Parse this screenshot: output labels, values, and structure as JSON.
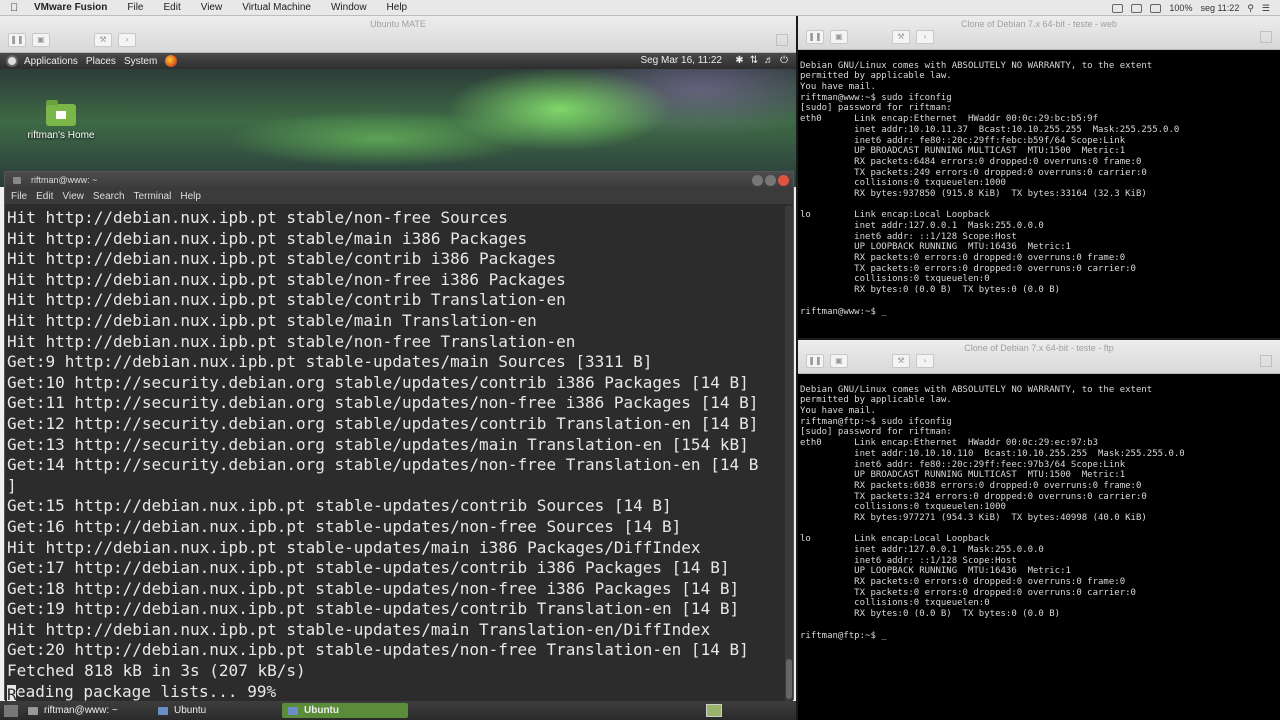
{
  "menubar": {
    "app": "VMware Fusion",
    "items": [
      "File",
      "Edit",
      "View",
      "Virtual Machine",
      "Window",
      "Help"
    ],
    "right": {
      "battery": "100%",
      "clock": "seg 11:22"
    }
  },
  "vm_left": {
    "title": "Ubuntu MATE"
  },
  "mate_panel": {
    "menus": [
      "Applications",
      "Places",
      "System"
    ],
    "clock": "Seg Mar 16, 11:22"
  },
  "desktop": {
    "home_label": "riftman's Home"
  },
  "terminal": {
    "title": "riftman@www: ~",
    "menu": [
      "File",
      "Edit",
      "View",
      "Search",
      "Terminal",
      "Help"
    ],
    "lines": [
      "Hit http://debian.nux.ipb.pt stable/non-free Sources",
      "Hit http://debian.nux.ipb.pt stable/main i386 Packages",
      "Hit http://debian.nux.ipb.pt stable/contrib i386 Packages",
      "Hit http://debian.nux.ipb.pt stable/non-free i386 Packages",
      "Hit http://debian.nux.ipb.pt stable/contrib Translation-en",
      "Hit http://debian.nux.ipb.pt stable/main Translation-en",
      "Hit http://debian.nux.ipb.pt stable/non-free Translation-en",
      "Get:9 http://debian.nux.ipb.pt stable-updates/main Sources [3311 B]",
      "Get:10 http://security.debian.org stable/updates/contrib i386 Packages [14 B]",
      "Get:11 http://security.debian.org stable/updates/non-free i386 Packages [14 B]",
      "Get:12 http://security.debian.org stable/updates/contrib Translation-en [14 B]",
      "Get:13 http://security.debian.org stable/updates/main Translation-en [154 kB]",
      "Get:14 http://security.debian.org stable/updates/non-free Translation-en [14 B",
      "]",
      "Get:15 http://debian.nux.ipb.pt stable-updates/contrib Sources [14 B]",
      "Get:16 http://debian.nux.ipb.pt stable-updates/non-free Sources [14 B]",
      "Hit http://debian.nux.ipb.pt stable-updates/main i386 Packages/DiffIndex",
      "Get:17 http://debian.nux.ipb.pt stable-updates/contrib i386 Packages [14 B]",
      "Get:18 http://debian.nux.ipb.pt stable-updates/non-free i386 Packages [14 B]",
      "Get:19 http://debian.nux.ipb.pt stable-updates/contrib Translation-en [14 B]",
      "Hit http://debian.nux.ipb.pt stable-updates/main Translation-en/DiffIndex",
      "Get:20 http://debian.nux.ipb.pt stable-updates/non-free Translation-en [14 B]",
      "Fetched 818 kB in 3s (207 kB/s)"
    ],
    "last_line_cursor_char": "R",
    "last_line_rest": "eading package lists... 99%"
  },
  "taskbar": {
    "tasks": [
      "riftman@www: ~",
      "Ubuntu",
      "Ubuntu"
    ]
  },
  "vm_web": {
    "title": "Clone of Debian 7.x 64-bit - teste - web",
    "lines": [
      "",
      "Debian GNU/Linux comes with ABSOLUTELY NO WARRANTY, to the extent",
      "permitted by applicable law.",
      "You have mail.",
      "riftman@www:~$ sudo ifconfig",
      "[sudo] password for riftman:",
      "eth0      Link encap:Ethernet  HWaddr 00:0c:29:bc:b5:9f",
      "          inet addr:10.10.11.37  Bcast:10.10.255.255  Mask:255.255.0.0",
      "          inet6 addr: fe80::20c:29ff:febc:b59f/64 Scope:Link",
      "          UP BROADCAST RUNNING MULTICAST  MTU:1500  Metric:1",
      "          RX packets:6484 errors:0 dropped:0 overruns:0 frame:0",
      "          TX packets:249 errors:0 dropped:0 overruns:0 carrier:0",
      "          collisions:0 txqueuelen:1000",
      "          RX bytes:937850 (915.8 KiB)  TX bytes:33164 (32.3 KiB)",
      "",
      "lo        Link encap:Local Loopback",
      "          inet addr:127.0.0.1  Mask:255.0.0.0",
      "          inet6 addr: ::1/128 Scope:Host",
      "          UP LOOPBACK RUNNING  MTU:16436  Metric:1",
      "          RX packets:0 errors:0 dropped:0 overruns:0 frame:0",
      "          TX packets:0 errors:0 dropped:0 overruns:0 carrier:0",
      "          collisions:0 txqueuelen:0",
      "          RX bytes:0 (0.0 B)  TX bytes:0 (0.0 B)",
      "",
      "riftman@www:~$ _"
    ]
  },
  "vm_ftp": {
    "title": "Clone of Debian 7.x 64-bit - teste - ftp",
    "lines": [
      "",
      "Debian GNU/Linux comes with ABSOLUTELY NO WARRANTY, to the extent",
      "permitted by applicable law.",
      "You have mail.",
      "riftman@ftp:~$ sudo ifconfig",
      "[sudo] password for riftman:",
      "eth0      Link encap:Ethernet  HWaddr 00:0c:29:ec:97:b3",
      "          inet addr:10.10.10.110  Bcast:10.10.255.255  Mask:255.255.0.0",
      "          inet6 addr: fe80::20c:29ff:feec:97b3/64 Scope:Link",
      "          UP BROADCAST RUNNING MULTICAST  MTU:1500  Metric:1",
      "          RX packets:6038 errors:0 dropped:0 overruns:0 frame:0",
      "          TX packets:324 errors:0 dropped:0 overruns:0 carrier:0",
      "          collisions:0 txqueuelen:1000",
      "          RX bytes:977271 (954.3 KiB)  TX bytes:40998 (40.0 KiB)",
      "",
      "lo        Link encap:Local Loopback",
      "          inet addr:127.0.0.1  Mask:255.0.0.0",
      "          inet6 addr: ::1/128 Scope:Host",
      "          UP LOOPBACK RUNNING  MTU:16436  Metric:1",
      "          RX packets:0 errors:0 dropped:0 overruns:0 frame:0",
      "          TX packets:0 errors:0 dropped:0 overruns:0 carrier:0",
      "          collisions:0 txqueuelen:0",
      "          RX bytes:0 (0.0 B)  TX bytes:0 (0.0 B)",
      "",
      "riftman@ftp:~$ _"
    ]
  }
}
